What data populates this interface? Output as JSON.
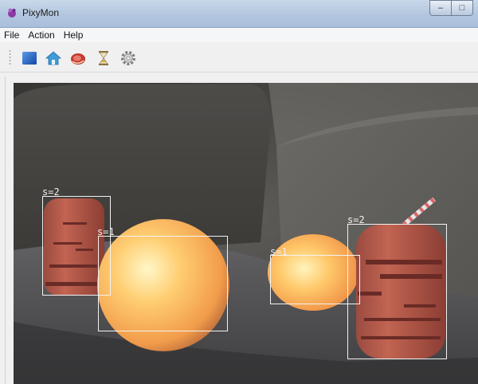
{
  "window": {
    "title": "PixyMon"
  },
  "window_controls": {
    "minimize": "–",
    "maximize": "□"
  },
  "menu": {
    "items": [
      "File",
      "Action",
      "Help"
    ]
  },
  "toolbar": {
    "buttons": [
      {
        "icon": "blue-square-icon"
      },
      {
        "icon": "home-icon"
      },
      {
        "icon": "steak-icon"
      },
      {
        "icon": "hourglass-icon"
      },
      {
        "icon": "gear-icon"
      }
    ]
  },
  "detections": [
    {
      "label": "s=2"
    },
    {
      "label": "s=1"
    },
    {
      "label": "s=1"
    },
    {
      "label": "s=2"
    }
  ]
}
